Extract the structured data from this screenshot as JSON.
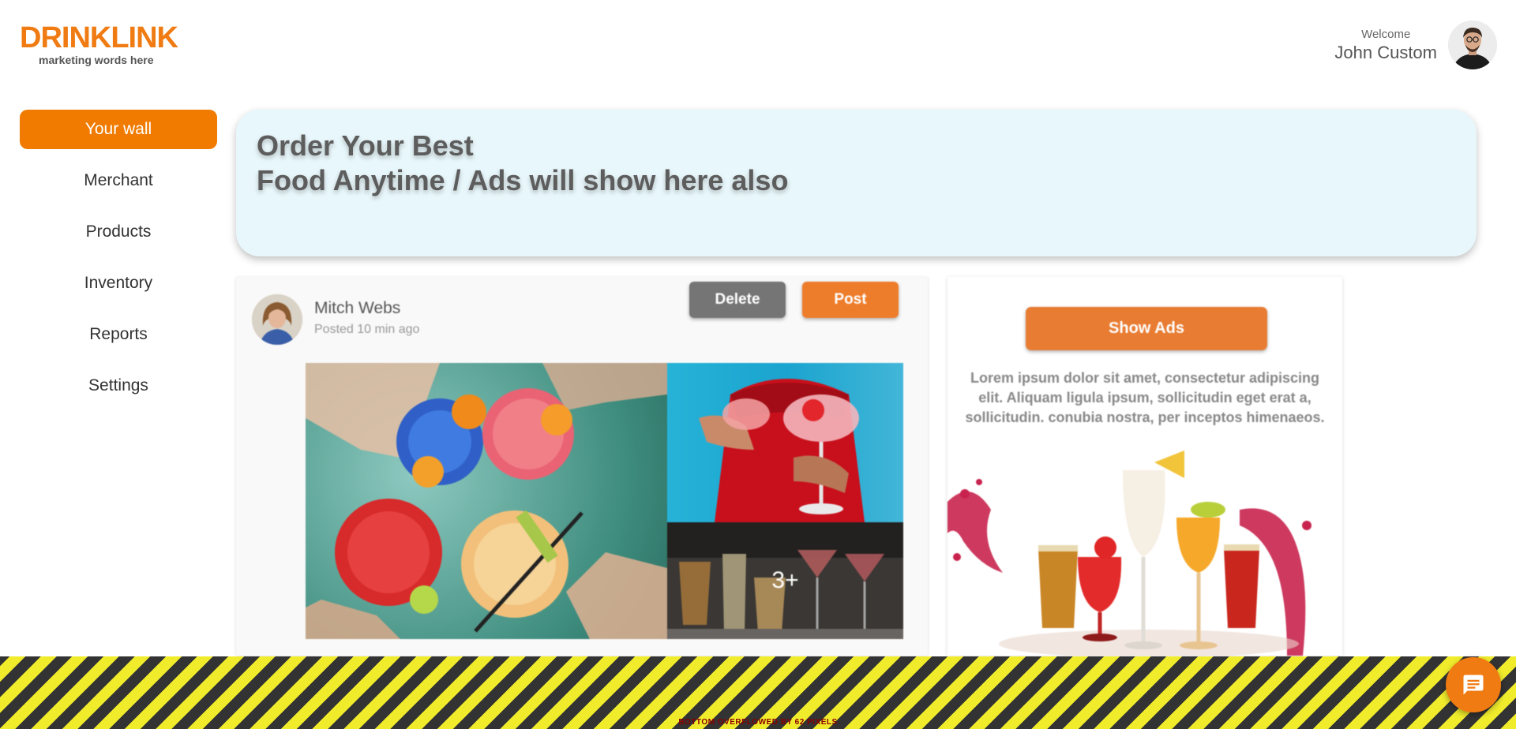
{
  "brand": {
    "title": "DRINKLINK",
    "tagline": "marketing words here"
  },
  "user": {
    "welcome": "Welcome",
    "name": "John Custom"
  },
  "sidebar": {
    "items": [
      {
        "label": "Your wall",
        "active": true
      },
      {
        "label": "Merchant",
        "active": false
      },
      {
        "label": "Products",
        "active": false
      },
      {
        "label": "Inventory",
        "active": false
      },
      {
        "label": "Reports",
        "active": false
      },
      {
        "label": "Settings",
        "active": false
      }
    ]
  },
  "banner": {
    "line1": "Order Your Best",
    "line2": "Food Anytime / Ads will show here also"
  },
  "post": {
    "author": "Mitch Webs",
    "time": "Posted 10 min ago",
    "delete_label": "Delete",
    "post_label": "Post",
    "more_photos": "3+"
  },
  "ads": {
    "button_label": "Show Ads",
    "text": "Lorem ipsum dolor sit amet, consectetur adipiscing elit. Aliquam ligula ipsum, sollicitudin eget erat a, sollicitudin. conubia nostra, per inceptos himenaeos."
  },
  "overflow_warning": "BOTTOM OVERFLOWED BY 62 PIXELS",
  "colors": {
    "accent": "#f07b12",
    "banner_bg": "#e8f7fb",
    "delete_button": "#757575",
    "post_button": "#ee7d2b"
  },
  "icons": {
    "chat": "chat-icon"
  }
}
